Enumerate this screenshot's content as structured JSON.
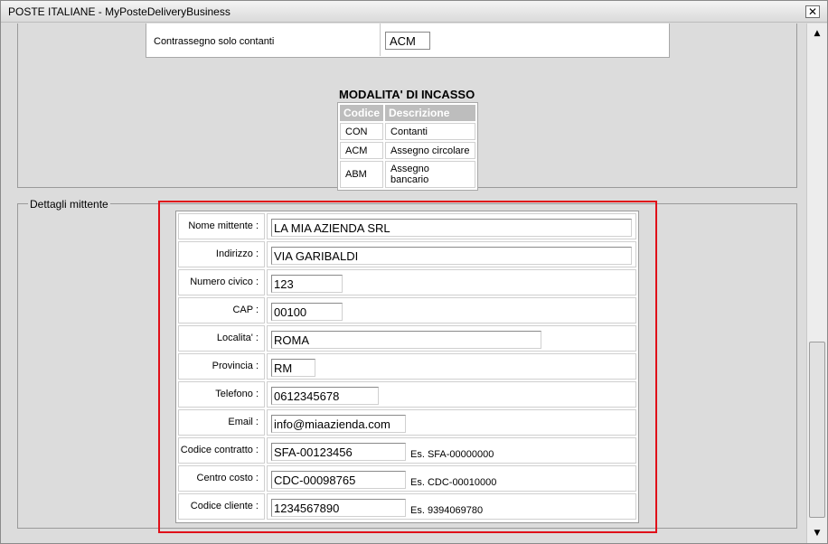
{
  "window": {
    "title": "POSTE ITALIANE - MyPosteDeliveryBusiness",
    "close_label": "✕"
  },
  "payment": {
    "label": "Contrassegno solo contanti",
    "value": "ACM"
  },
  "incasso": {
    "title": "MODALITA' DI INCASSO",
    "headers": [
      "Codice",
      "Descrizione"
    ],
    "rows": [
      {
        "code": "CON",
        "desc": "Contanti"
      },
      {
        "code": "ACM",
        "desc": "Assegno circolare"
      },
      {
        "code": "ABM",
        "desc": "Assegno bancario"
      }
    ]
  },
  "sender": {
    "legend": "Dettagli mittente",
    "fields": [
      {
        "label": "Nome mittente :",
        "value": "LA MIA AZIENDA SRL",
        "hint": ""
      },
      {
        "label": "Indirizzo :",
        "value": "VIA GARIBALDI",
        "hint": ""
      },
      {
        "label": "Numero civico :",
        "value": "123",
        "hint": ""
      },
      {
        "label": "CAP :",
        "value": "00100",
        "hint": ""
      },
      {
        "label": "Localita' :",
        "value": "ROMA",
        "hint": ""
      },
      {
        "label": "Provincia :",
        "value": "RM",
        "hint": ""
      },
      {
        "label": "Telefono :",
        "value": "0612345678",
        "hint": ""
      },
      {
        "label": "Email :",
        "value": "info@miaazienda.com",
        "hint": ""
      },
      {
        "label": "Codice contratto :",
        "value": "SFA-00123456",
        "hint": "Es. SFA-00000000"
      },
      {
        "label": "Centro costo :",
        "value": "CDC-00098765",
        "hint": "Es. CDC-00010000"
      },
      {
        "label": "Codice cliente :",
        "value": "1234567890",
        "hint": "Es. 9394069780"
      }
    ]
  },
  "scrollbar": {
    "up_icon": "▲",
    "down_icon": "▼"
  }
}
